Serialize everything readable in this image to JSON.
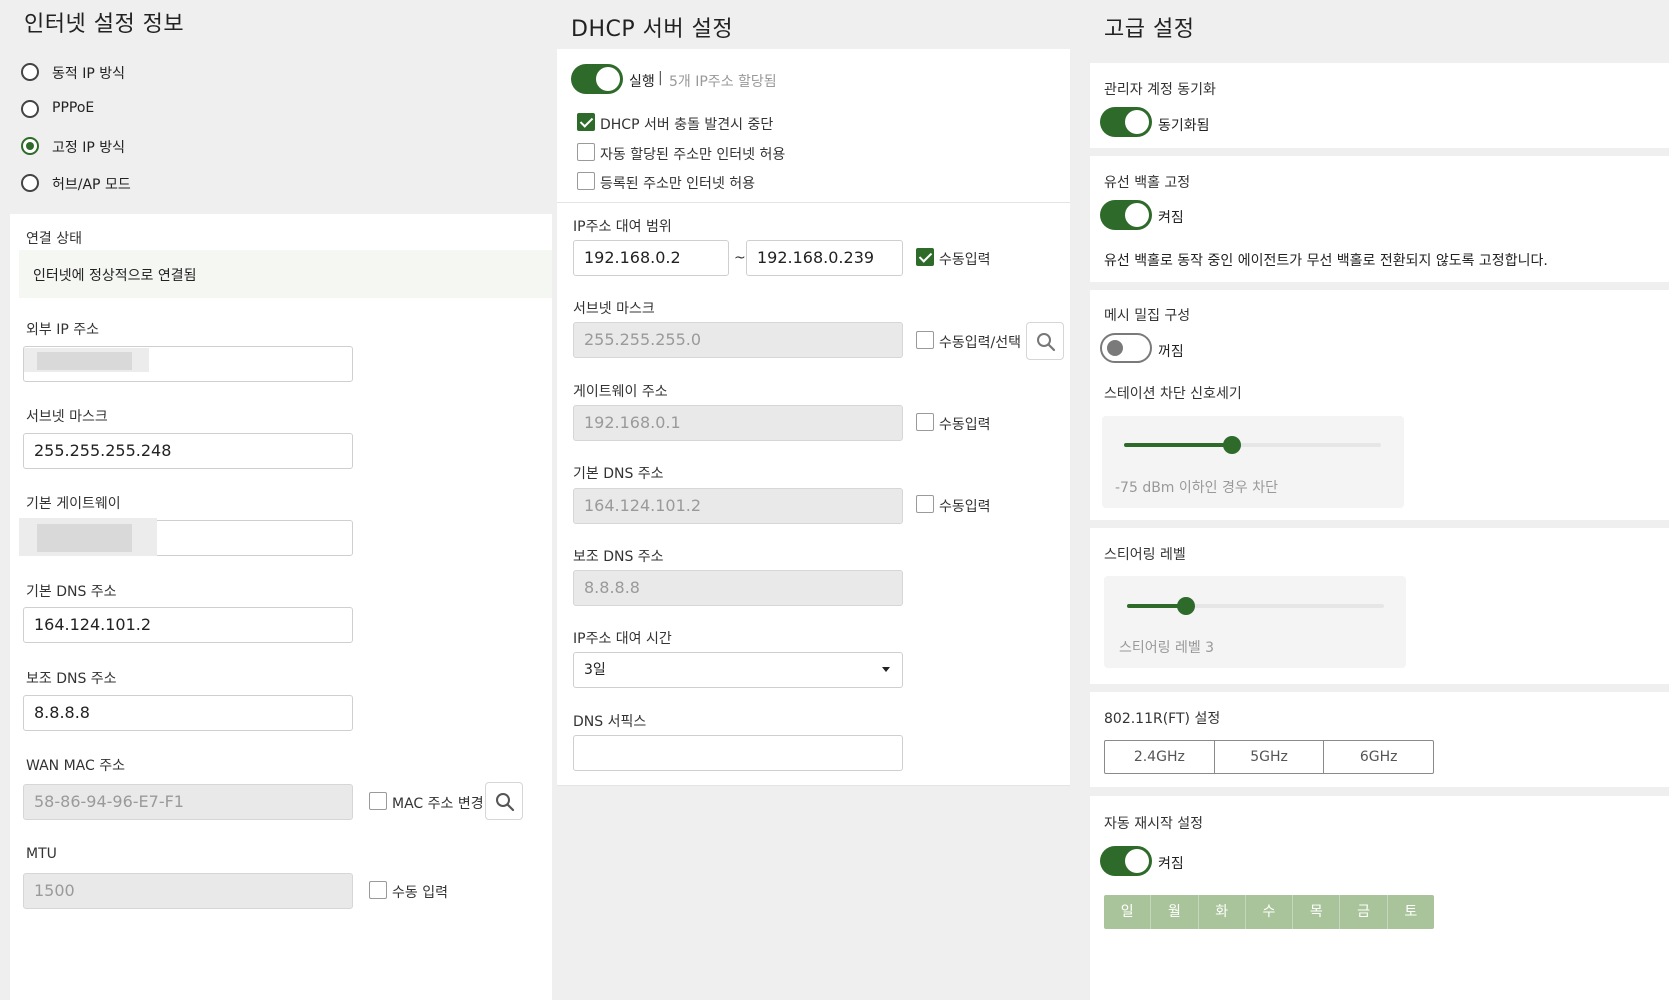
{
  "internet": {
    "title": "인터넷 설정 정보",
    "modes": [
      "동적 IP 방식",
      "PPPoE",
      "고정 IP 방식",
      "허브/AP 모드"
    ],
    "selected_mode": "고정 IP 방식",
    "status_label": "연결 상태",
    "status_text": "인터넷에 정상적으로 연결됨",
    "external_ip_label": "외부 IP 주소",
    "subnet_label": "서브넷 마스크",
    "subnet_value": "255.255.255.248",
    "gateway_label": "기본 게이트웨이",
    "dns1_label": "기본 DNS 주소",
    "dns1_value": "164.124.101.2",
    "dns2_label": "보조 DNS 주소",
    "dns2_value": "8.8.8.8",
    "wan_mac_label": "WAN MAC 주소",
    "wan_mac_value": "58-86-94-96-E7-F1",
    "mac_change_label": "MAC 주소 변경",
    "mtu_label": "MTU",
    "mtu_value": "1500",
    "mtu_manual_label": "수동 입력"
  },
  "dhcp": {
    "title": "DHCP 서버 설정",
    "running_label": "실행",
    "separator": "|",
    "assigned_text": "5개 IP주소 할당됨",
    "options": [
      {
        "label": "DHCP 서버 충돌 발견시 중단",
        "checked": true
      },
      {
        "label": "자동 할당된 주소만 인터넷 허용",
        "checked": false
      },
      {
        "label": "등록된 주소만 인터넷 허용",
        "checked": false
      }
    ],
    "range_label": "IP주소 대여 범위",
    "range_start": "192.168.0.2",
    "range_sep": "~",
    "range_end": "192.168.0.239",
    "manual_label": "수동입력",
    "subnet_label": "서브넷 마스크",
    "subnet_value": "255.255.255.0",
    "subnet_manual_label": "수동입력/선택",
    "gateway_label": "게이트웨이 주소",
    "gateway_value": "192.168.0.1",
    "dns1_label": "기본 DNS 주소",
    "dns1_value": "164.124.101.2",
    "dns2_label": "보조 DNS 주소",
    "dns2_value": "8.8.8.8",
    "lease_label": "IP주소 대여 시간",
    "lease_value": "3일",
    "suffix_label": "DNS 서픽스",
    "suffix_value": ""
  },
  "advanced": {
    "title": "고급 설정",
    "admin_sync_label": "관리자 계정 동기화",
    "admin_sync_state": "동기화됨",
    "wired_backhaul_label": "유선 백홀 고정",
    "wired_backhaul_state": "켜짐",
    "wired_backhaul_desc": "유선 백홀로 동작 중인 에이전트가 무선 백홀로 전환되지 않도록 고정합니다.",
    "mesh_label": "메시 밀집 구성",
    "mesh_state": "꺼짐",
    "station_label": "스테이션 차단 신호세기",
    "station_slider_fraction": 0.42,
    "station_caption": "-75 dBm 이하인 경우 차단",
    "steering_label": "스티어링 레벨",
    "steering_slider_fraction": 0.23,
    "steering_caption": "스티어링 레벨 3",
    "ft_label": "802.11R(FT) 설정",
    "ft_bands": [
      "2.4GHz",
      "5GHz",
      "6GHz"
    ],
    "restart_label": "자동 재시작 설정",
    "restart_state": "켜짐",
    "days": [
      "일",
      "월",
      "화",
      "수",
      "목",
      "금",
      "토"
    ]
  },
  "colors": {
    "accent": "#2e6b2a",
    "day_bg": "#a9c49a"
  }
}
